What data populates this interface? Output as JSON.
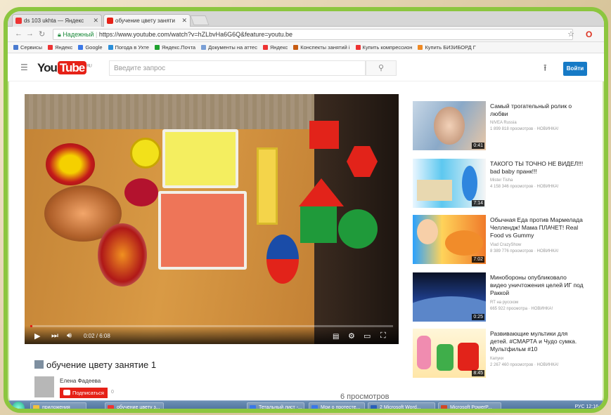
{
  "tabs": [
    {
      "label": "ds 103 ukhta — Яндекс",
      "active": false
    },
    {
      "label": "обучение цвету заняти",
      "active": true
    }
  ],
  "omnibox": {
    "secure_label": "Надежный",
    "url": "https://www.youtube.com/watch?v=hZLbvHa6G6Q&feature=youtu.be"
  },
  "bookmarks": [
    {
      "label": "Сервисы",
      "color": "#4a7bd0"
    },
    {
      "label": "Яндекс",
      "color": "#e33"
    },
    {
      "label": "Google",
      "color": "#3b78e7"
    },
    {
      "label": "Погода в Ухте",
      "color": "#2a8fd9"
    },
    {
      "label": "Яндекс.Почта",
      "color": "#1fa12e"
    },
    {
      "label": "Документы на аттес",
      "color": "#7a9fd6"
    },
    {
      "label": "Яндекс",
      "color": "#e33"
    },
    {
      "label": "Конспекты занятий і",
      "color": "#c75b12"
    },
    {
      "label": "Купить компрессион",
      "color": "#e33"
    },
    {
      "label": "Купить БИЗИБОРД Г",
      "color": "#f08a24"
    }
  ],
  "youtube": {
    "logo_you": "You",
    "logo_tube": "Tube",
    "logo_region": "RU",
    "search_placeholder": "Введите запрос",
    "signin_label": "Войти"
  },
  "player": {
    "time": "0:02 / 6:08",
    "progress": 0.005
  },
  "video": {
    "title": "обучение цвету занятие 1",
    "channel": "Елена Фадеева",
    "subscribe_label": "Подписаться",
    "subscriber_count": "0",
    "views": "6 просмотров"
  },
  "suggestions": [
    {
      "title": "Самый трогательный ролик о любви",
      "channel": "NIVEA Russia",
      "meta": "1 899 818 просмотров · НОВИНКА!",
      "duration": "0:41"
    },
    {
      "title": "ТАКОГО ТЫ ТОЧНО НЕ ВИДЕЛ!!! bad baby пранк!!!",
      "channel": "Mister Tisha",
      "meta": "4 158 346 просмотров · НОВИНКА!",
      "duration": "7:14"
    },
    {
      "title": "Обычная Еда против Мармелада Челлендж! Мама ПЛАЧЕТ! Real Food vs Gummy",
      "channel": "Vlad CrazyShow",
      "meta": "8 389 776 просмотров · НОВИНКА!",
      "duration": "7:02"
    },
    {
      "title": "Минобороны опубликовало видео уничтожения целей ИГ под Раккой",
      "channel": "RT на русском",
      "meta": "665 922 просмотра · НОВИНКА!",
      "duration": "0:25"
    },
    {
      "title": "Развивающие мультики для детей. #СМАРТА и Чудо сумка. Мультфильм #10",
      "channel": "Капуки",
      "meta": "2 267 460 просмотров · НОВИНКА!",
      "duration": "8:45"
    }
  ],
  "taskbar": {
    "items": [
      {
        "label": "приложения",
        "color": "#f0c040"
      },
      {
        "label": "обучение цвету з...",
        "color": "#e33"
      },
      {
        "label": "Тетальный лист -...",
        "color": "#3b78e7"
      },
      {
        "label": "Мои о протесте...",
        "color": "#3b78e7"
      },
      {
        "label": "2 Microsoft Word...",
        "color": "#2b5fb8"
      },
      {
        "label": "Microsoft PowerP...",
        "color": "#d24726"
      }
    ],
    "lang": "РУС",
    "clock": "12:16"
  }
}
